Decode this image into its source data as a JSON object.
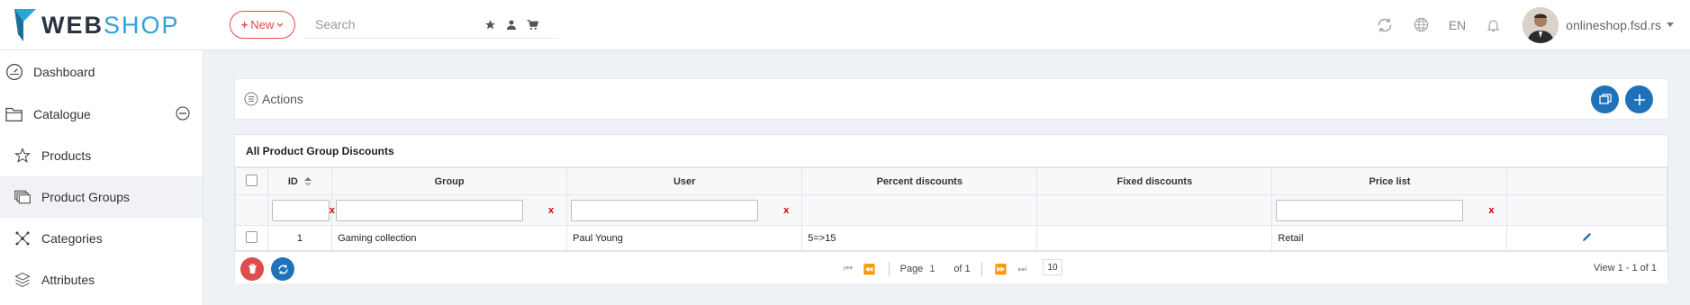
{
  "brand": {
    "logo_text_a": "WEB",
    "logo_text_b": "SHOP",
    "accent": "#2ea3d6"
  },
  "header": {
    "new_label": "New",
    "search_placeholder": "Search",
    "search_icons": [
      "star-icon",
      "user-icon",
      "cart-icon"
    ],
    "right_icons": [
      "refresh-icon",
      "globe-icon",
      "bell-icon"
    ],
    "language": "EN",
    "user": "onlineshop.fsd.rs"
  },
  "sidebar": {
    "items": [
      {
        "label": "Dashboard",
        "icon": "dashboard-icon"
      },
      {
        "label": "Catalogue",
        "icon": "folder-icon"
      },
      {
        "label": "Products",
        "icon": "star-icon"
      },
      {
        "label": "Product Groups",
        "icon": "layers-icon",
        "active": true
      },
      {
        "label": "Categories",
        "icon": "network-icon"
      },
      {
        "label": "Attributes",
        "icon": "stack-icon"
      }
    ]
  },
  "actions": {
    "label": "Actions"
  },
  "grid": {
    "title": "All Product Group Discounts",
    "columns": [
      "ID",
      "Group",
      "User",
      "Percent discounts",
      "Fixed discounts",
      "Price list"
    ],
    "filter_clear": "x",
    "rows": [
      {
        "id": "1",
        "group": "Gaming collection",
        "user": "Paul Young",
        "percent": "5=>15",
        "fixed": "",
        "price_list": "Retail"
      }
    ],
    "pager": {
      "page_label": "Page",
      "page_value": "1",
      "of_label": "of 1",
      "page_size": "10",
      "view_info": "View 1 - 1 of 1"
    }
  },
  "colors": {
    "primary": "#1f72b9",
    "danger": "#e04b4b"
  }
}
